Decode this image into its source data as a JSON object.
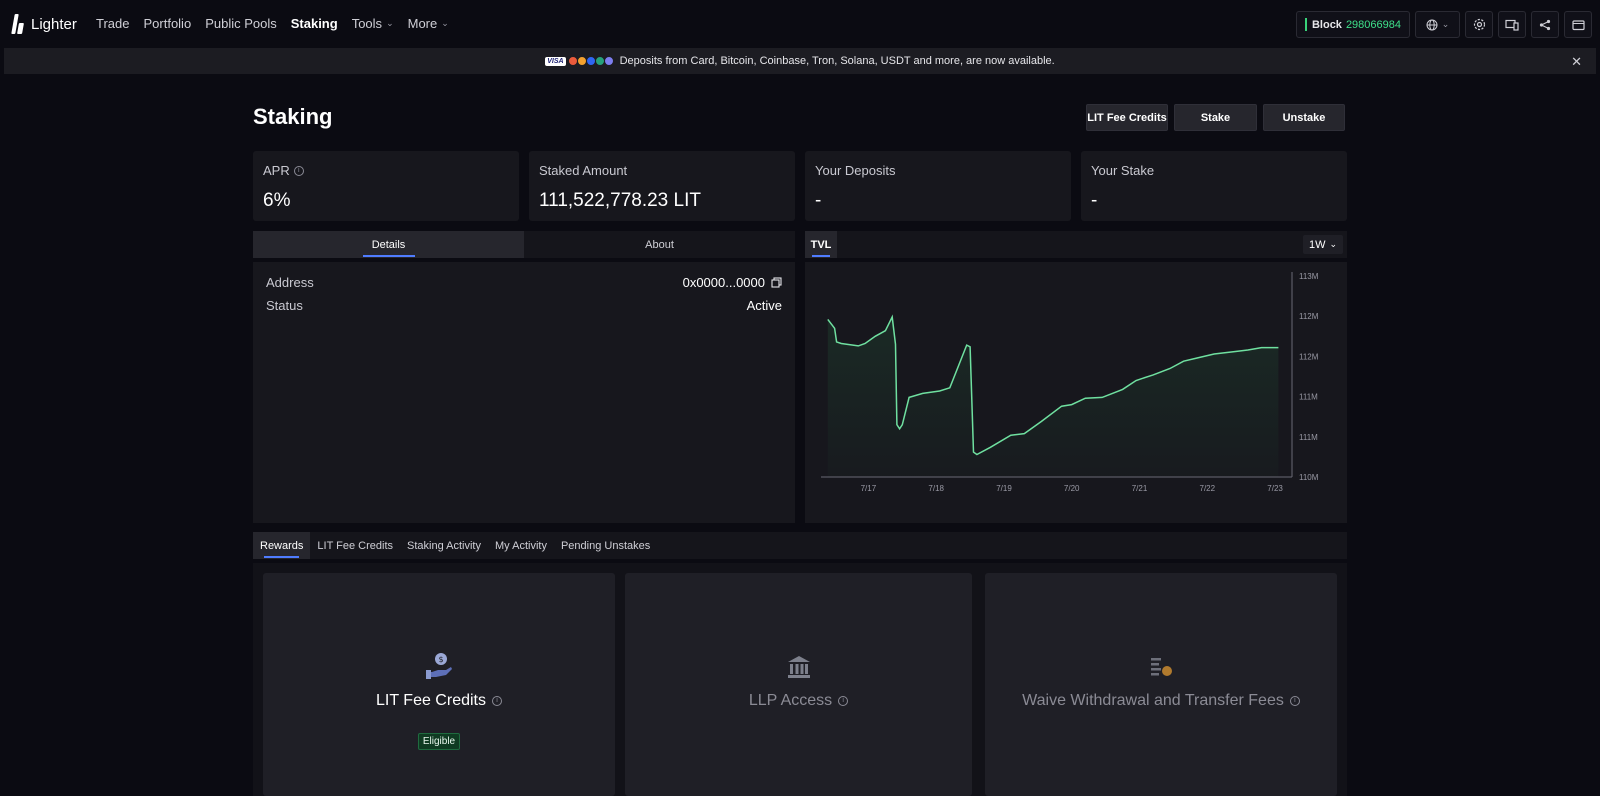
{
  "brand": {
    "name": "Lighter"
  },
  "nav": {
    "links": [
      {
        "label": "Trade"
      },
      {
        "label": "Portfolio"
      },
      {
        "label": "Public Pools"
      },
      {
        "label": "Staking",
        "active": true
      },
      {
        "label": "Tools"
      },
      {
        "label": "More"
      }
    ],
    "block_label": "Block",
    "block_number": "298066984",
    "icons": [
      "globe-icon",
      "settings-icon",
      "devices-icon",
      "share-icon",
      "wallet-icon"
    ]
  },
  "banner": {
    "text": "Deposits from Card, Bitcoin, Coinbase, Tron, Solana, USDT and more, are now available.",
    "visa": "VISA"
  },
  "page": {
    "title": "Staking",
    "actions": {
      "lit_fee_credits": "LIT Fee Credits",
      "stake": "Stake",
      "unstake": "Unstake"
    }
  },
  "stats": {
    "apr": {
      "label": "APR",
      "value": "6%"
    },
    "staked": {
      "label": "Staked Amount",
      "value": "111,522,778.23 LIT"
    },
    "deposits": {
      "label": "Your Deposits",
      "value": "-"
    },
    "stake": {
      "label": "Your Stake",
      "value": "-"
    }
  },
  "details": {
    "tabs": [
      "Details",
      "About"
    ],
    "address_label": "Address",
    "address_value": "0x0000...0000",
    "status_label": "Status",
    "status_value": "Active"
  },
  "chart": {
    "tab": "TVL",
    "range": "1W"
  },
  "chart_data": {
    "type": "area",
    "title": "",
    "xlabel": "",
    "ylabel": "",
    "x_ticks": [
      "7/17",
      "7/18",
      "7/19",
      "7/20",
      "7/21",
      "7/22",
      "7/23"
    ],
    "y_ticks": [
      "113M",
      "112M",
      "112M",
      "111M",
      "111M",
      "110M"
    ],
    "ylim": [
      110,
      112.5
    ],
    "line_color": "#6fe0a0",
    "series": [
      {
        "x": [
          16.9,
          17.0,
          17.03,
          17.1,
          17.35,
          17.45,
          17.6,
          17.75,
          17.85,
          17.9,
          17.92,
          17.96,
          18.0,
          18.1,
          18.3,
          18.55,
          18.7,
          18.95,
          19.0,
          19.05,
          19.1,
          19.3,
          19.6,
          19.8,
          20.05,
          20.35,
          20.5,
          20.7,
          20.95,
          21.25,
          21.45,
          21.7,
          21.95,
          22.15,
          22.35,
          22.6,
          22.9,
          23.1,
          23.3,
          23.55
        ],
        "y": [
          111.96,
          111.85,
          111.68,
          111.66,
          111.63,
          111.66,
          111.75,
          111.82,
          111.99,
          111.65,
          110.65,
          110.6,
          110.65,
          110.99,
          111.04,
          111.07,
          111.11,
          111.64,
          111.62,
          110.31,
          110.28,
          110.37,
          110.52,
          110.54,
          110.69,
          110.88,
          110.9,
          110.98,
          110.99,
          111.09,
          111.2,
          111.27,
          111.35,
          111.44,
          111.48,
          111.53,
          111.56,
          111.58,
          111.61,
          111.61
        ]
      }
    ],
    "grid": false
  },
  "rewards": {
    "tabs": [
      "Rewards",
      "LIT Fee Credits",
      "Staking Activity",
      "My Activity",
      "Pending Unstakes"
    ],
    "cards": [
      {
        "title": "LIT Fee Credits",
        "badge": "Eligible",
        "icon": "hand-coin-icon"
      },
      {
        "title": "LLP Access",
        "icon": "bank-icon"
      },
      {
        "title": "Waive Withdrawal and Transfer Fees",
        "icon": "fee-coin-icon"
      }
    ]
  },
  "colors": {
    "accent": "#4f7cff",
    "positive": "#3ee08a",
    "background": "#0b0b12",
    "card": "#17171d"
  }
}
